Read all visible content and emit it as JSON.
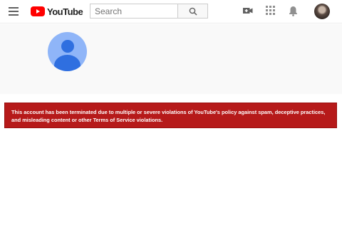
{
  "header": {
    "logo_text": "YouTube",
    "search_placeholder": "Search",
    "icons": [
      "hamburger-menu-icon",
      "youtube-logo-icon",
      "search-icon",
      "create-video-icon",
      "apps-grid-icon",
      "notifications-bell-icon",
      "account-avatar"
    ]
  },
  "colors": {
    "brand_red": "#ff0000",
    "alert_background": "#b61a1a",
    "avatar_placeholder": "#8fb5f8",
    "avatar_figure": "#2f6fe0"
  },
  "alert": {
    "message": "This account has been terminated due to multiple or severe violations of YouTube's policy against spam, deceptive practices, and misleading content or other Terms of Service violations."
  }
}
